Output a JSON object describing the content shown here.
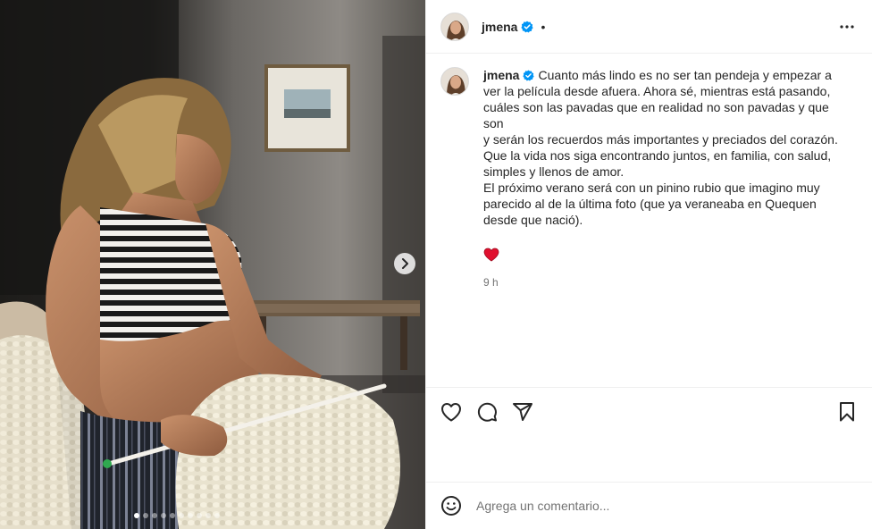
{
  "post": {
    "username": "jmena",
    "header_separator": "•",
    "caption": {
      "lines": [
        "Cuanto más lindo es no ser tan pendeja y empezar a",
        "ver la película desde afuera. Ahora sé, mientras está pasando,",
        "cuáles son las pavadas que en realidad no son pavadas y que son",
        "y serán los recuerdos más importantes y preciados del corazón.",
        "Que la vida nos siga encontrando juntos, en familia, con salud,",
        "simples y llenos de amor.",
        "El próximo verano será con un pinino rubio que imagino muy",
        "parecido al de la última foto (que ya veraneaba en Quequen",
        "desde que nació)."
      ]
    },
    "time_ago": "9 h",
    "carousel": {
      "total": 10,
      "active_index": 0
    }
  },
  "comment": {
    "placeholder": "Agrega un comentario..."
  },
  "colors": {
    "verified_badge": "#0095f6",
    "heart_emoji": "#e0102e",
    "text_primary": "#262626",
    "text_secondary": "#737373",
    "divider": "#efefef"
  },
  "icons": {
    "verified": "verified-badge-icon",
    "more": "more-options-icon",
    "next": "chevron-right-icon",
    "like": "heart-icon",
    "comment": "comment-bubble-icon",
    "share": "paper-plane-icon",
    "save": "bookmark-icon",
    "emoji": "emoji-smiley-icon"
  }
}
